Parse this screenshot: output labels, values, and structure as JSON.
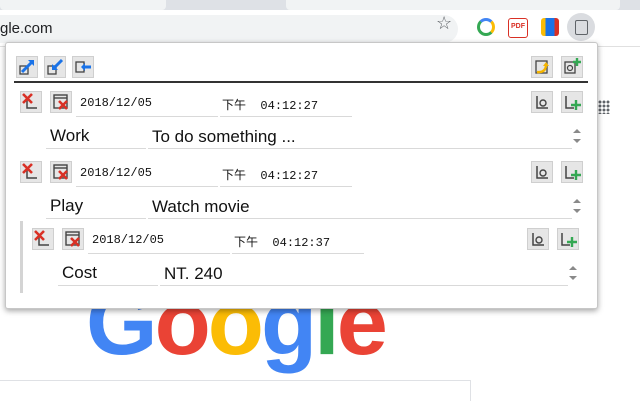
{
  "browser": {
    "url_fragment": "gle.com"
  },
  "google_logo": {
    "letters": [
      "G",
      "o",
      "o",
      "g",
      "l",
      "e"
    ],
    "colors": [
      "#4285f4",
      "#ea4335",
      "#fbbc05",
      "#4285f4",
      "#34a853",
      "#ea4335"
    ]
  },
  "toolbar_icons": [
    "move-out-icon",
    "import-icon",
    "export-icon"
  ],
  "toolbar_right_icons": [
    "refresh-icon",
    "add-note-icon"
  ],
  "entries": [
    {
      "date": "2018/12/05",
      "ampm": "下午",
      "time": "04:12:27",
      "key": "Work",
      "value": "To do something ..."
    },
    {
      "date": "2018/12/05",
      "ampm": "下午",
      "time": "04:12:27",
      "key": "Play",
      "value": "Watch movie"
    },
    {
      "date": "2018/12/05",
      "ampm": "下午",
      "time": "04:12:37",
      "key": "Cost",
      "value": "NT. 240"
    }
  ]
}
